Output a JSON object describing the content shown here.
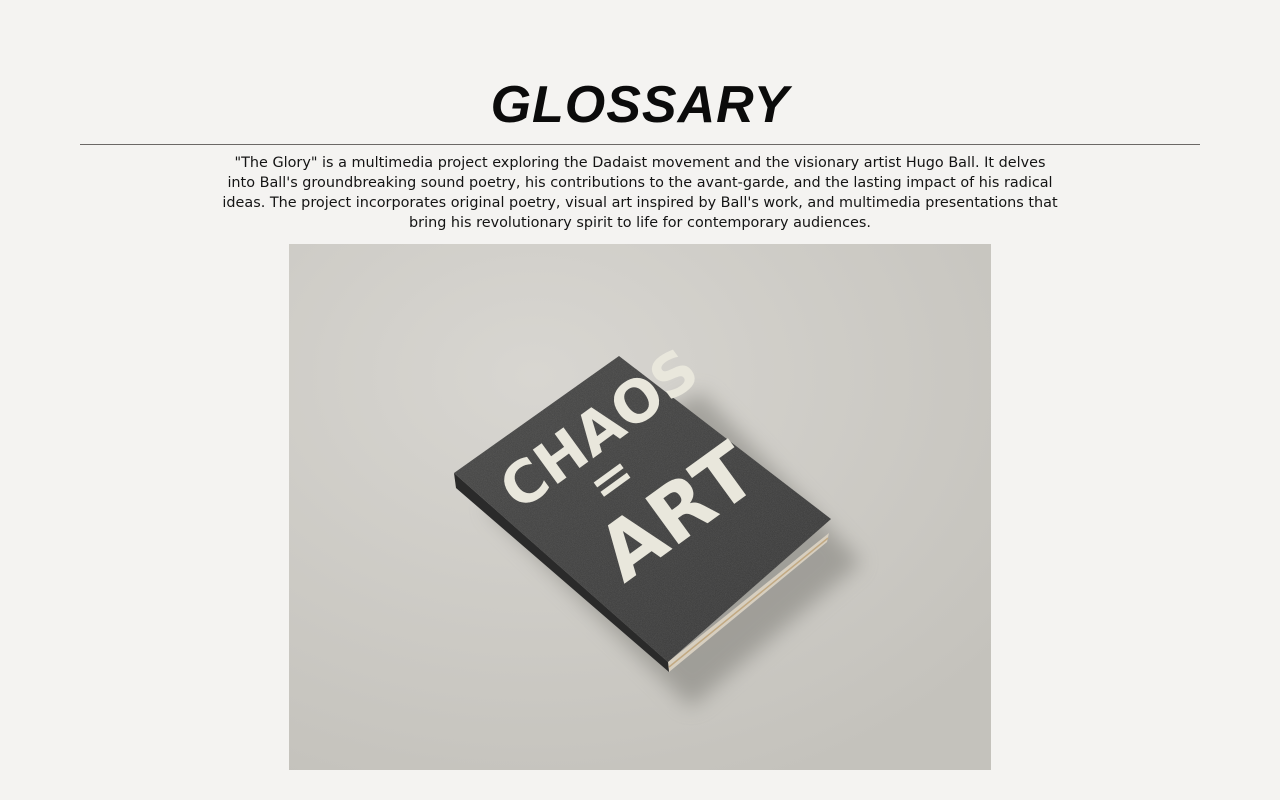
{
  "heading": {
    "title": "GLOSSARY"
  },
  "intro": {
    "text": "\"The Glory\" is a multimedia project exploring the Dadaist movement and the visionary artist Hugo Ball. It delves into Ball's groundbreaking sound poetry, his contributions to the avant-garde, and the lasting impact of his radical ideas. The project incorporates original poetry, visual art inspired by Ball's work, and multimedia presentations that bring his revolutionary spirit to life for contemporary audiences."
  },
  "book": {
    "cover_line_1": "CHAOS",
    "cover_line_2": "=",
    "cover_line_3": "ART",
    "cover_color": "#3b3b3b",
    "lettering_color": "#e9e7dc"
  }
}
